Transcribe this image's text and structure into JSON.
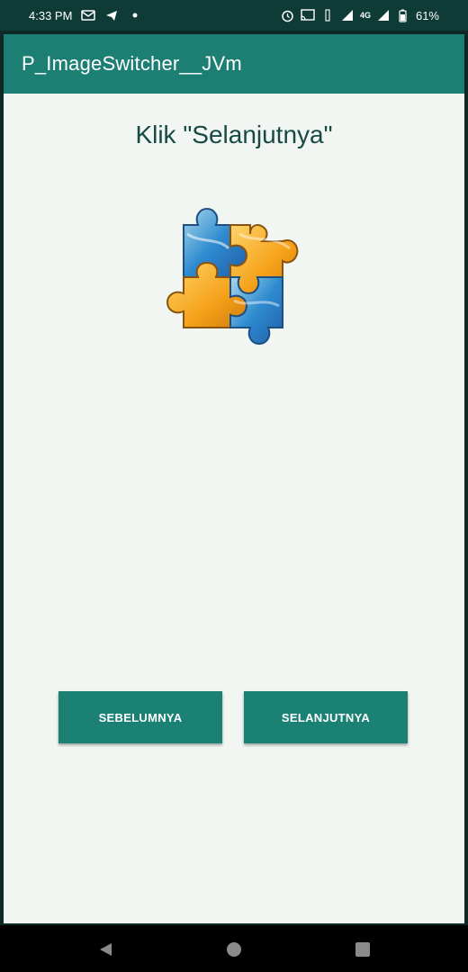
{
  "status_bar": {
    "time": "4:33 PM",
    "battery": "61%",
    "network": "4G"
  },
  "app_bar": {
    "title": "P_ImageSwitcher__JVm"
  },
  "main": {
    "heading": "Klik \"Selanjutnya\"",
    "image_icon": "puzzle-pieces-icon"
  },
  "buttons": {
    "prev_label": "SEBELUMNYA",
    "next_label": "SELANJUTNYA"
  },
  "nav_bar": {
    "back_icon": "back-icon",
    "home_icon": "home-icon",
    "recents_icon": "recents-icon"
  },
  "colors": {
    "primary": "#1d7f73",
    "primary_dark": "#0f3b36",
    "button": "#1b8174",
    "background": "#f1f6f2",
    "heading_text": "#174a44"
  }
}
